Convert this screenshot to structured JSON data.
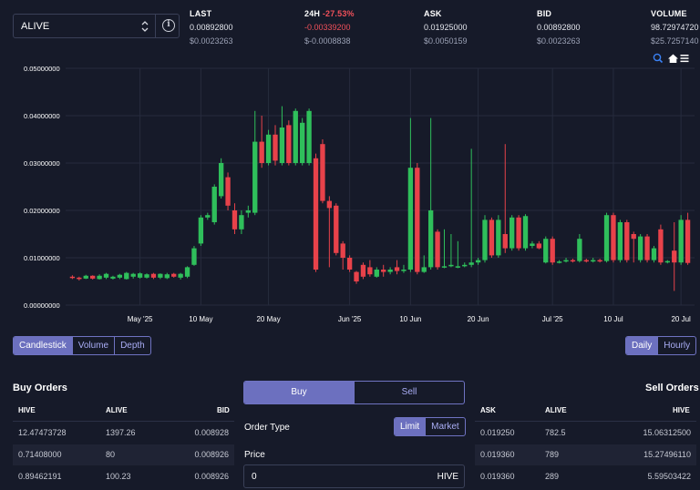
{
  "token_select": {
    "value": "ALIVE",
    "arrows_icon": "chevron-up-down-icon",
    "info_icon": "info-icon"
  },
  "stats": {
    "last": {
      "label": "LAST",
      "value": "0.00892800",
      "usd": "$0.0023263"
    },
    "change24h": {
      "label": "24H",
      "pct": "-27.53%",
      "value": "-0.00339200",
      "usd": "$-0.0008838"
    },
    "ask": {
      "label": "ASK",
      "value": "0.01925000",
      "usd": "$0.0050159"
    },
    "bid": {
      "label": "BID",
      "value": "0.00892800",
      "usd": "$0.0023263"
    },
    "volume": {
      "label": "VOLUME",
      "value": "98.72974720",
      "usd": "$25.7257140"
    }
  },
  "colors": {
    "up": "#2fbf5b",
    "down": "#e8424a",
    "accent": "#6c70bf",
    "bg": "#161a29"
  },
  "chart_icons": [
    "zoom-icon",
    "home-icon",
    "menu-icon"
  ],
  "chart_data": {
    "type": "candlestick",
    "y_ticks": [
      "0.05000000",
      "0.04000000",
      "0.03000000",
      "0.02000000",
      "0.01000000",
      "0.00000000"
    ],
    "ylim": [
      0,
      0.05
    ],
    "x_ticks": [
      "May '25",
      "10 May",
      "20 May",
      "Jun '25",
      "10 Jun",
      "20 Jun",
      "Jul '25",
      "10 Jul",
      "20 Jul"
    ],
    "x_tick_days": [
      30,
      39,
      49,
      61,
      70,
      80,
      91,
      100,
      110
    ],
    "grid": true,
    "candles": [
      {
        "d": 20,
        "o": 0.006,
        "c": 0.0058,
        "h": 0.0063,
        "l": 0.0055
      },
      {
        "d": 21,
        "o": 0.0058,
        "c": 0.0055,
        "h": 0.006,
        "l": 0.0052
      },
      {
        "d": 22,
        "o": 0.0056,
        "c": 0.0062,
        "h": 0.0064,
        "l": 0.0055
      },
      {
        "d": 23,
        "o": 0.0062,
        "c": 0.0056,
        "h": 0.0063,
        "l": 0.0054
      },
      {
        "d": 24,
        "o": 0.0055,
        "c": 0.0062,
        "h": 0.0065,
        "l": 0.0054
      },
      {
        "d": 25,
        "o": 0.0058,
        "c": 0.0066,
        "h": 0.0068,
        "l": 0.0055
      },
      {
        "d": 26,
        "o": 0.0056,
        "c": 0.006,
        "h": 0.0062,
        "l": 0.0054
      },
      {
        "d": 27,
        "o": 0.0058,
        "c": 0.0064,
        "h": 0.0066,
        "l": 0.0055
      },
      {
        "d": 28,
        "o": 0.0055,
        "c": 0.0068,
        "h": 0.007,
        "l": 0.0054
      },
      {
        "d": 29,
        "o": 0.006,
        "c": 0.0066,
        "h": 0.0068,
        "l": 0.0056
      },
      {
        "d": 30,
        "o": 0.0058,
        "c": 0.0067,
        "h": 0.0069,
        "l": 0.0056
      },
      {
        "d": 31,
        "o": 0.0058,
        "c": 0.0065,
        "h": 0.0067,
        "l": 0.0056
      },
      {
        "d": 32,
        "o": 0.0066,
        "c": 0.0058,
        "h": 0.0068,
        "l": 0.0055
      },
      {
        "d": 33,
        "o": 0.0058,
        "c": 0.0066,
        "h": 0.0067,
        "l": 0.0055
      },
      {
        "d": 34,
        "o": 0.0057,
        "c": 0.0065,
        "h": 0.0068,
        "l": 0.0055
      },
      {
        "d": 35,
        "o": 0.0066,
        "c": 0.006,
        "h": 0.0068,
        "l": 0.0058
      },
      {
        "d": 36,
        "o": 0.0058,
        "c": 0.0066,
        "h": 0.0068,
        "l": 0.0054
      },
      {
        "d": 37,
        "o": 0.006,
        "c": 0.008,
        "h": 0.0082,
        "l": 0.0057
      },
      {
        "d": 38,
        "o": 0.0085,
        "c": 0.012,
        "h": 0.0125,
        "l": 0.0083
      },
      {
        "d": 39,
        "o": 0.013,
        "c": 0.0185,
        "h": 0.019,
        "l": 0.0125
      },
      {
        "d": 40,
        "o": 0.0185,
        "c": 0.019,
        "h": 0.0195,
        "l": 0.018
      },
      {
        "d": 41,
        "o": 0.0175,
        "c": 0.025,
        "h": 0.0255,
        "l": 0.017
      },
      {
        "d": 42,
        "o": 0.023,
        "c": 0.03,
        "h": 0.031,
        "l": 0.0225
      },
      {
        "d": 43,
        "o": 0.027,
        "c": 0.021,
        "h": 0.028,
        "l": 0.02
      },
      {
        "d": 44,
        "o": 0.02,
        "c": 0.016,
        "h": 0.0215,
        "l": 0.015
      },
      {
        "d": 45,
        "o": 0.016,
        "c": 0.019,
        "h": 0.02,
        "l": 0.015
      },
      {
        "d": 46,
        "o": 0.0195,
        "c": 0.02,
        "h": 0.021,
        "l": 0.0185
      },
      {
        "d": 47,
        "o": 0.0195,
        "c": 0.0345,
        "h": 0.041,
        "l": 0.019
      },
      {
        "d": 48,
        "o": 0.0345,
        "c": 0.03,
        "h": 0.04,
        "l": 0.029
      },
      {
        "d": 49,
        "o": 0.03,
        "c": 0.036,
        "h": 0.037,
        "l": 0.0295
      },
      {
        "d": 50,
        "o": 0.036,
        "c": 0.0305,
        "h": 0.038,
        "l": 0.0295
      },
      {
        "d": 51,
        "o": 0.03,
        "c": 0.0375,
        "h": 0.042,
        "l": 0.0295
      },
      {
        "d": 52,
        "o": 0.038,
        "c": 0.03,
        "h": 0.039,
        "l": 0.0295
      },
      {
        "d": 53,
        "o": 0.03,
        "c": 0.041,
        "h": 0.0415,
        "l": 0.0295
      },
      {
        "d": 54,
        "o": 0.03,
        "c": 0.0385,
        "h": 0.0395,
        "l": 0.0295
      },
      {
        "d": 55,
        "o": 0.03,
        "c": 0.041,
        "h": 0.0415,
        "l": 0.0295
      },
      {
        "d": 56,
        "o": 0.031,
        "c": 0.0075,
        "h": 0.032,
        "l": 0.007
      },
      {
        "d": 57,
        "o": 0.034,
        "c": 0.022,
        "h": 0.035,
        "l": 0.0215
      },
      {
        "d": 58,
        "o": 0.022,
        "c": 0.0205,
        "h": 0.023,
        "l": 0.008
      },
      {
        "d": 59,
        "o": 0.021,
        "c": 0.011,
        "h": 0.0215,
        "l": 0.0105
      },
      {
        "d": 60,
        "o": 0.013,
        "c": 0.01,
        "h": 0.0135,
        "l": 0.0075
      },
      {
        "d": 61,
        "o": 0.01,
        "c": 0.0075,
        "h": 0.0105,
        "l": 0.007
      },
      {
        "d": 62,
        "o": 0.007,
        "c": 0.005,
        "h": 0.0072,
        "l": 0.0045
      },
      {
        "d": 63,
        "o": 0.0085,
        "c": 0.006,
        "h": 0.009,
        "l": 0.0055
      },
      {
        "d": 64,
        "o": 0.008,
        "c": 0.0065,
        "h": 0.0095,
        "l": 0.006
      },
      {
        "d": 65,
        "o": 0.006,
        "c": 0.0075,
        "h": 0.008,
        "l": 0.0058
      },
      {
        "d": 66,
        "o": 0.0075,
        "c": 0.007,
        "h": 0.0085,
        "l": 0.006
      },
      {
        "d": 67,
        "o": 0.007,
        "c": 0.0075,
        "h": 0.008,
        "l": 0.0065
      },
      {
        "d": 68,
        "o": 0.008,
        "c": 0.0072,
        "h": 0.0095,
        "l": 0.0065
      },
      {
        "d": 69,
        "o": 0.0072,
        "c": 0.0075,
        "h": 0.0085,
        "l": 0.0068
      },
      {
        "d": 70,
        "o": 0.0075,
        "c": 0.029,
        "h": 0.0395,
        "l": 0.007
      },
      {
        "d": 71,
        "o": 0.029,
        "c": 0.007,
        "h": 0.03,
        "l": 0.0065
      },
      {
        "d": 72,
        "o": 0.007,
        "c": 0.008,
        "h": 0.0105,
        "l": 0.0068
      },
      {
        "d": 73,
        "o": 0.008,
        "c": 0.02,
        "h": 0.0395,
        "l": 0.0075
      },
      {
        "d": 74,
        "o": 0.0155,
        "c": 0.008,
        "h": 0.016,
        "l": 0.0075
      },
      {
        "d": 75,
        "o": 0.008,
        "c": 0.0082,
        "h": 0.016,
        "l": 0.0078
      },
      {
        "d": 76,
        "o": 0.0082,
        "c": 0.0085,
        "h": 0.015,
        "l": 0.008
      },
      {
        "d": 77,
        "o": 0.008,
        "c": 0.0082,
        "h": 0.0135,
        "l": 0.0078
      },
      {
        "d": 78,
        "o": 0.0082,
        "c": 0.0085,
        "h": 0.009,
        "l": 0.008
      },
      {
        "d": 79,
        "o": 0.0085,
        "c": 0.009,
        "h": 0.033,
        "l": 0.008
      },
      {
        "d": 80,
        "o": 0.009,
        "c": 0.0095,
        "h": 0.01,
        "l": 0.0085
      },
      {
        "d": 81,
        "o": 0.0095,
        "c": 0.018,
        "h": 0.019,
        "l": 0.009
      },
      {
        "d": 82,
        "o": 0.018,
        "c": 0.0105,
        "h": 0.0185,
        "l": 0.01
      },
      {
        "d": 83,
        "o": 0.0105,
        "c": 0.018,
        "h": 0.019,
        "l": 0.01
      },
      {
        "d": 84,
        "o": 0.015,
        "c": 0.012,
        "h": 0.034,
        "l": 0.011
      },
      {
        "d": 85,
        "o": 0.012,
        "c": 0.0185,
        "h": 0.019,
        "l": 0.0115
      },
      {
        "d": 86,
        "o": 0.0185,
        "c": 0.012,
        "h": 0.019,
        "l": 0.0115
      },
      {
        "d": 87,
        "o": 0.012,
        "c": 0.0188,
        "h": 0.0192,
        "l": 0.0115
      },
      {
        "d": 88,
        "o": 0.0125,
        "c": 0.013,
        "h": 0.0135,
        "l": 0.012
      },
      {
        "d": 89,
        "o": 0.013,
        "c": 0.012,
        "h": 0.0135,
        "l": 0.0118
      },
      {
        "d": 90,
        "o": 0.009,
        "c": 0.014,
        "h": 0.0145,
        "l": 0.0088
      },
      {
        "d": 91,
        "o": 0.014,
        "c": 0.009,
        "h": 0.0145,
        "l": 0.0085
      },
      {
        "d": 92,
        "o": 0.009,
        "c": 0.0092,
        "h": 0.0095,
        "l": 0.0088
      },
      {
        "d": 93,
        "o": 0.0092,
        "c": 0.0095,
        "h": 0.01,
        "l": 0.009
      },
      {
        "d": 94,
        "o": 0.0095,
        "c": 0.0093,
        "h": 0.0098,
        "l": 0.009
      },
      {
        "d": 95,
        "o": 0.0093,
        "c": 0.014,
        "h": 0.015,
        "l": 0.009
      },
      {
        "d": 96,
        "o": 0.0095,
        "c": 0.0093,
        "h": 0.0098,
        "l": 0.009
      },
      {
        "d": 97,
        "o": 0.0093,
        "c": 0.0095,
        "h": 0.01,
        "l": 0.009
      },
      {
        "d": 98,
        "o": 0.0095,
        "c": 0.0093,
        "h": 0.0098,
        "l": 0.009
      },
      {
        "d": 99,
        "o": 0.0093,
        "c": 0.019,
        "h": 0.0195,
        "l": 0.009
      },
      {
        "d": 100,
        "o": 0.019,
        "c": 0.0095,
        "h": 0.0195,
        "l": 0.009
      },
      {
        "d": 101,
        "o": 0.0095,
        "c": 0.0175,
        "h": 0.018,
        "l": 0.009
      },
      {
        "d": 102,
        "o": 0.0175,
        "c": 0.0095,
        "h": 0.018,
        "l": 0.009
      },
      {
        "d": 103,
        "o": 0.015,
        "c": 0.014,
        "h": 0.0155,
        "l": 0.009
      },
      {
        "d": 104,
        "o": 0.0095,
        "c": 0.0145,
        "h": 0.015,
        "l": 0.009
      },
      {
        "d": 105,
        "o": 0.0145,
        "c": 0.0095,
        "h": 0.015,
        "l": 0.009
      },
      {
        "d": 106,
        "o": 0.0095,
        "c": 0.012,
        "h": 0.0125,
        "l": 0.009
      },
      {
        "d": 107,
        "o": 0.016,
        "c": 0.009,
        "h": 0.017,
        "l": 0.0085
      },
      {
        "d": 108,
        "o": 0.009,
        "c": 0.0093,
        "h": 0.0095,
        "l": 0.0088
      },
      {
        "d": 109,
        "o": 0.0115,
        "c": 0.009,
        "h": 0.0175,
        "l": 0.003
      },
      {
        "d": 110,
        "o": 0.009,
        "c": 0.018,
        "h": 0.019,
        "l": 0.0085
      },
      {
        "d": 111,
        "o": 0.018,
        "c": 0.0089,
        "h": 0.0195,
        "l": 0.0085
      }
    ]
  },
  "chart_type_tabs": [
    "Candlestick",
    "Volume",
    "Depth"
  ],
  "interval_tabs": [
    "Daily",
    "Hourly"
  ],
  "buy_orders": {
    "title": "Buy Orders",
    "columns": [
      "HIVE",
      "ALIVE",
      "BID"
    ],
    "rows": [
      [
        "12.47473728",
        "1397.26",
        "0.008928"
      ],
      [
        "0.71408000",
        "80",
        "0.008926"
      ],
      [
        "0.89462191",
        "100.23",
        "0.008926"
      ]
    ]
  },
  "sell_orders": {
    "title": "Sell Orders",
    "columns": [
      "ASK",
      "ALIVE",
      "HIVE"
    ],
    "rows": [
      [
        "0.019250",
        "782.5",
        "15.06312500"
      ],
      [
        "0.019360",
        "789",
        "15.27496110"
      ],
      [
        "0.019360",
        "289",
        "5.59503422"
      ]
    ]
  },
  "order_form": {
    "buy_label": "Buy",
    "sell_label": "Sell",
    "order_type_label": "Order Type",
    "order_types": [
      "Limit",
      "Market"
    ],
    "price_label": "Price",
    "price_value": "0",
    "price_unit": "HIVE"
  }
}
